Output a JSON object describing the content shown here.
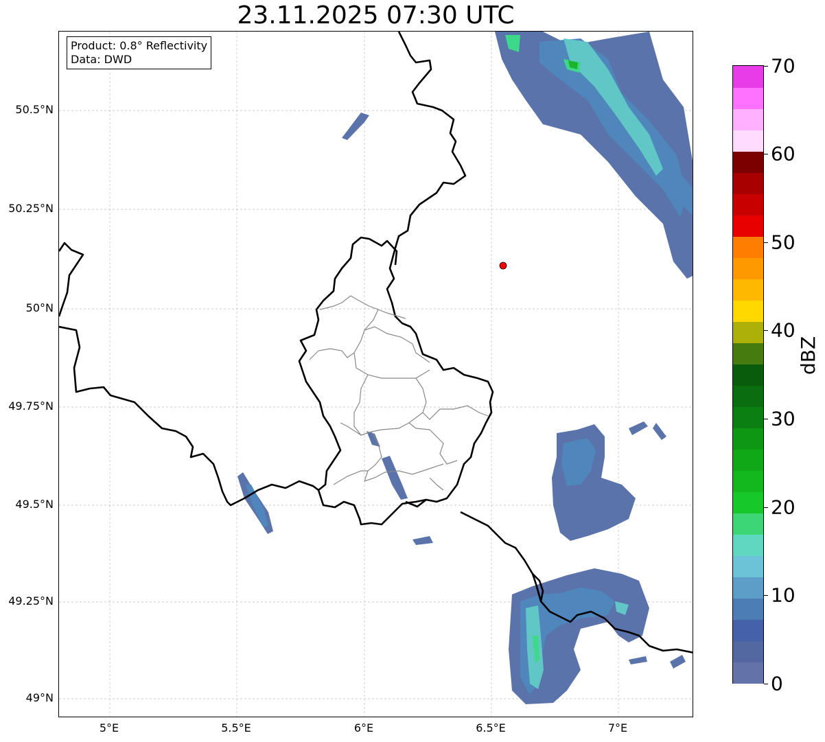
{
  "title": "23.11.2025 07:30 UTC",
  "info_box": {
    "product": "Product: 0.8° Reflectivity",
    "data_source": "Data: DWD"
  },
  "axes": {
    "latitude_ticks": [
      "50.5°N",
      "50.25°N",
      "50°N",
      "49.75°N",
      "49.5°N",
      "49.25°N",
      "49°N"
    ],
    "longitude_ticks": [
      "5°E",
      "5.5°E",
      "6°E",
      "6.5°E",
      "7°E"
    ],
    "lon_range": [
      4.8,
      7.3
    ],
    "lat_range": [
      48.95,
      50.7
    ],
    "gridlines": true
  },
  "colorbar": {
    "unit_label": "dBZ",
    "tick_labels": [
      "0",
      "10",
      "20",
      "30",
      "40",
      "50",
      "60",
      "70"
    ],
    "range": [
      0,
      70
    ],
    "colors": [
      "#6372a8",
      "#5368a0",
      "#4561a7",
      "#4c7db5",
      "#5d9ec9",
      "#6cc3d8",
      "#5fd8c2",
      "#3dd675",
      "#16c828",
      "#13b81f",
      "#10a817",
      "#0d9814",
      "#0b8012",
      "#0a6e10",
      "#085c0c",
      "#467c0f",
      "#adb009",
      "#ffd800",
      "#ffb800",
      "#ff9900",
      "#ff7d00",
      "#e80000",
      "#c80000",
      "#a80000",
      "#7c0000",
      "#ffdbff",
      "#ffb0ff",
      "#ff72ff",
      "#e93ce9"
    ]
  },
  "radar_site": {
    "lon": 6.55,
    "lat": 50.11,
    "color": "#ff0000"
  },
  "echo_colors": {
    "weak": "#5a73aa",
    "light": "#4f86bb",
    "moderate": "#61c6c6",
    "strong": "#3ed88a",
    "core": "#1ab52d"
  }
}
